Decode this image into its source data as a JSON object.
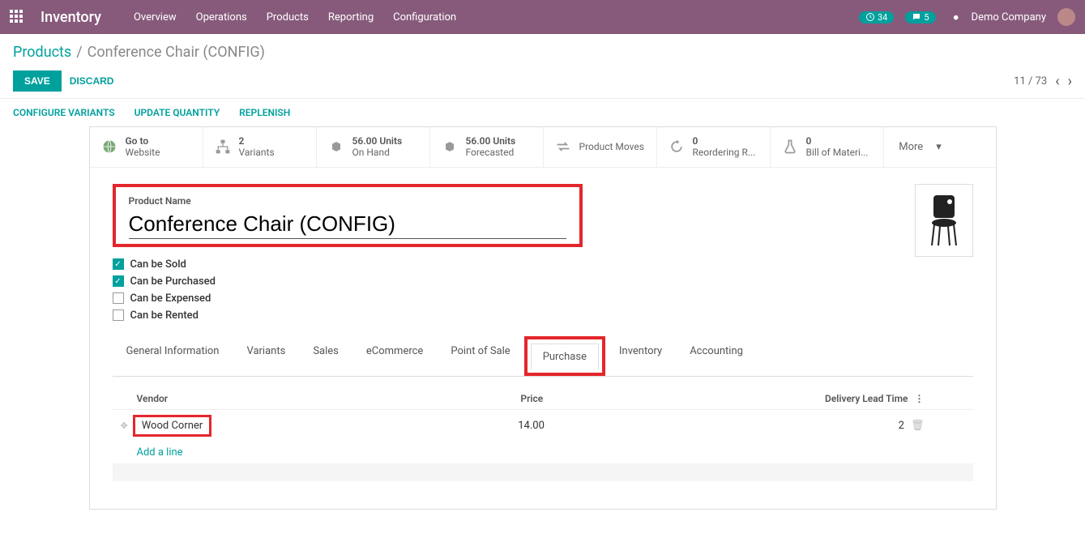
{
  "nav": {
    "module": "Inventory",
    "items": [
      "Overview",
      "Operations",
      "Products",
      "Reporting",
      "Configuration"
    ],
    "activity_count": "34",
    "msg_count": "5",
    "company": "Demo Company"
  },
  "breadcrumb": {
    "root": "Products",
    "current": "Conference Chair (CONFIG)"
  },
  "actions": {
    "save": "SAVE",
    "discard": "DISCARD",
    "pager": "11 / 73"
  },
  "secondary": [
    "CONFIGURE VARIANTS",
    "UPDATE QUANTITY",
    "REPLENISH"
  ],
  "stats": [
    {
      "top": "Go to",
      "bot": "Website"
    },
    {
      "top": "2",
      "bot": "Variants"
    },
    {
      "top": "56.00 Units",
      "bot": "On Hand"
    },
    {
      "top": "56.00 Units",
      "bot": "Forecasted"
    },
    {
      "top": "",
      "bot": "Product Moves"
    },
    {
      "top": "0",
      "bot": "Reordering R..."
    },
    {
      "top": "0",
      "bot": "Bill of Materi..."
    }
  ],
  "more": "More",
  "form": {
    "name_label": "Product Name",
    "name": "Conference Chair (CONFIG)",
    "checks": [
      {
        "label": "Can be Sold",
        "checked": true
      },
      {
        "label": "Can be Purchased",
        "checked": true
      },
      {
        "label": "Can be Expensed",
        "checked": false
      },
      {
        "label": "Can be Rented",
        "checked": false
      }
    ]
  },
  "tabs": [
    "General Information",
    "Variants",
    "Sales",
    "eCommerce",
    "Point of Sale",
    "Purchase",
    "Inventory",
    "Accounting"
  ],
  "active_tab": "Purchase",
  "vendor_table": {
    "headers": {
      "vendor": "Vendor",
      "price": "Price",
      "lead": "Delivery Lead Time"
    },
    "rows": [
      {
        "vendor": "Wood Corner",
        "price": "14.00",
        "lead": "2"
      }
    ],
    "add": "Add a line"
  }
}
